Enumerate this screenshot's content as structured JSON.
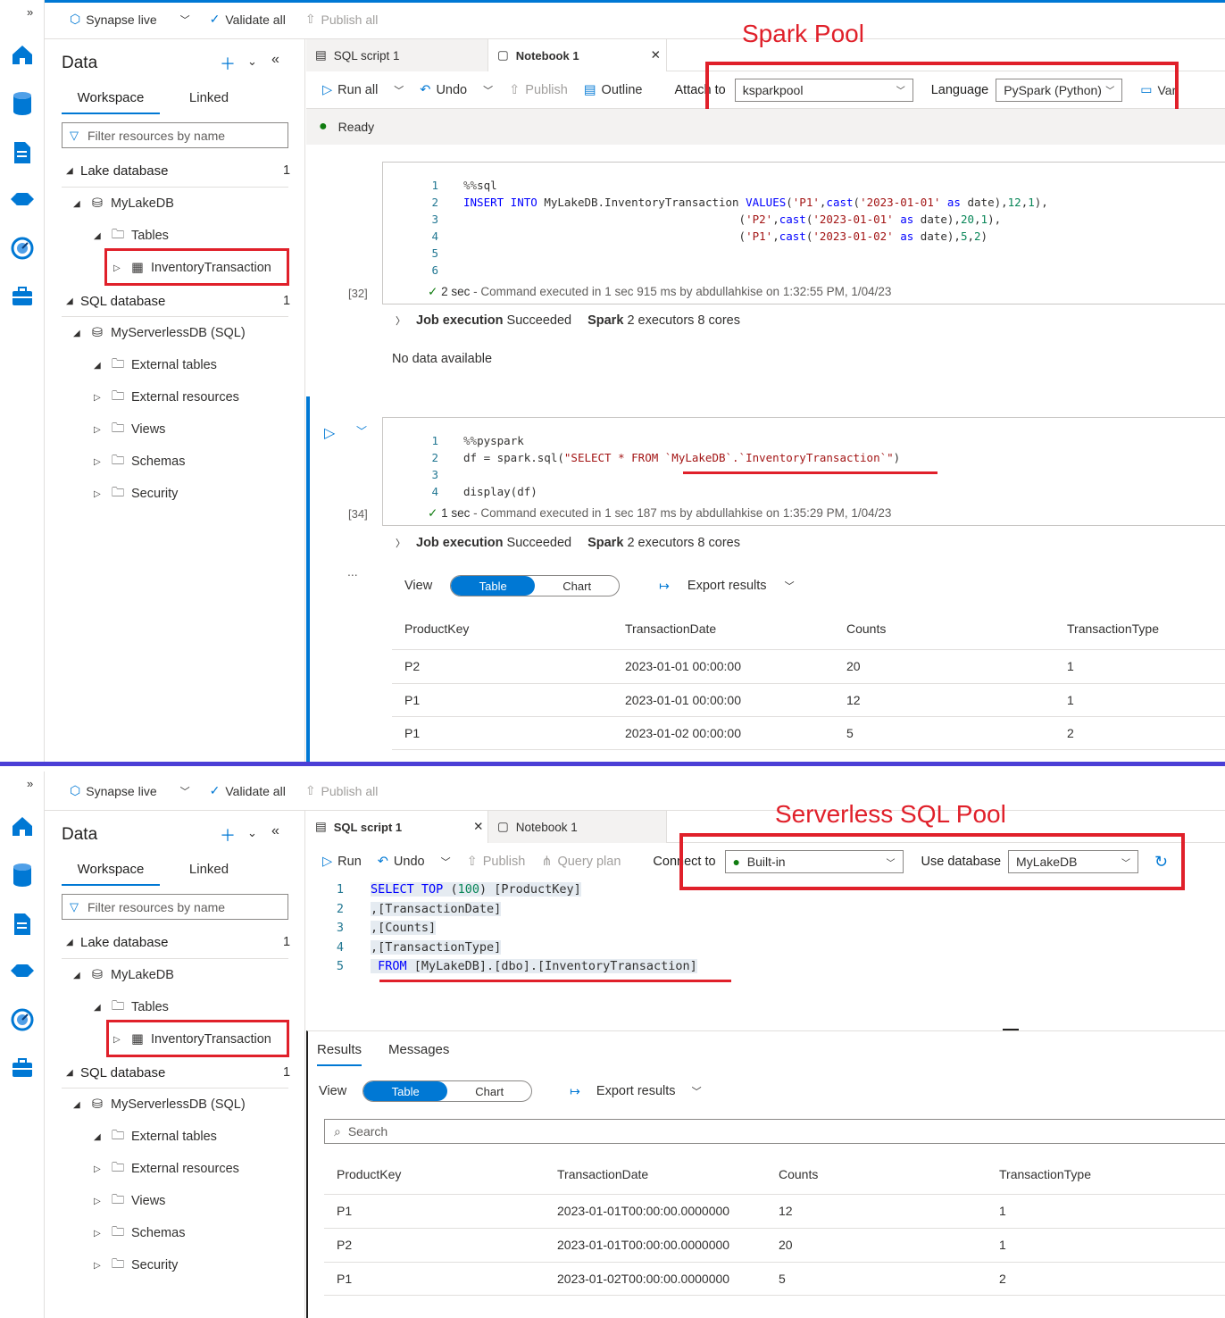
{
  "annotations": {
    "top": "Spark Pool",
    "bottom": "Serverless SQL Pool"
  },
  "header": {
    "live": "Synapse live",
    "validate": "Validate all",
    "publish": "Publish all"
  },
  "sidebar": {
    "title": "Data",
    "tabs": [
      "Workspace",
      "Linked"
    ],
    "filter_placeholder": "Filter resources by name",
    "lake_section": "Lake database",
    "lake_count": "1",
    "lake_db": "MyLakeDB",
    "tables": "Tables",
    "table_item": "InventoryTransaction",
    "sql_section": "SQL database",
    "sql_count": "1",
    "sql_db": "MyServerlessDB (SQL)",
    "sql_children": [
      "External tables",
      "External resources",
      "Views",
      "Schemas",
      "Security"
    ]
  },
  "top": {
    "tabs": [
      "SQL script 1",
      "Notebook 1"
    ],
    "toolbar": {
      "run_all": "Run all",
      "undo": "Undo",
      "publish": "Publish",
      "outline": "Outline",
      "attach_label": "Attach to",
      "attach_value": "ksparkpool",
      "language_label": "Language",
      "language_value": "PySpark (Python)",
      "var": "Var"
    },
    "status": "Ready",
    "cell1": {
      "exec_count": "[32]",
      "line_numbers": [
        "1",
        "2",
        "3",
        "4",
        "5",
        "6"
      ],
      "result_time": "2 sec",
      "result_text": "- Command executed in 1 sec 915 ms by abdullahkise on 1:32:55 PM, 1/04/23",
      "job_label": "Job execution",
      "job_status": "Succeeded",
      "spark_label": "Spark",
      "spark_info": "2 executors 8 cores",
      "no_data": "No data available"
    },
    "cell2": {
      "exec_count": "[34]",
      "line_numbers": [
        "1",
        "2",
        "3",
        "4"
      ],
      "result_time": "1 sec",
      "result_text": "- Command executed in 1 sec 187 ms by abdullahkise on 1:35:29 PM, 1/04/23",
      "job_label": "Job execution",
      "job_status": "Succeeded",
      "spark_label": "Spark",
      "spark_info": "2 executors 8 cores",
      "more": "..."
    },
    "view_label": "View",
    "toggle": [
      "Table",
      "Chart"
    ],
    "export": "Export results",
    "columns": [
      "ProductKey",
      "TransactionDate",
      "Counts",
      "TransactionType"
    ],
    "rows": [
      [
        "P2",
        "2023-01-01 00:00:00",
        "20",
        "1"
      ],
      [
        "P1",
        "2023-01-01 00:00:00",
        "12",
        "1"
      ],
      [
        "P1",
        "2023-01-02 00:00:00",
        "5",
        "2"
      ]
    ]
  },
  "bottom": {
    "tabs": [
      "SQL script 1",
      "Notebook 1"
    ],
    "toolbar": {
      "run": "Run",
      "undo": "Undo",
      "publish": "Publish",
      "query_plan": "Query plan",
      "connect_label": "Connect to",
      "connect_value": "Built-in",
      "db_label": "Use database",
      "db_value": "MyLakeDB"
    },
    "line_numbers": [
      "1",
      "2",
      "3",
      "4",
      "5"
    ],
    "result_tabs": [
      "Results",
      "Messages"
    ],
    "view_label": "View",
    "toggle": [
      "Table",
      "Chart"
    ],
    "export": "Export results",
    "search_placeholder": "Search",
    "columns": [
      "ProductKey",
      "TransactionDate",
      "Counts",
      "TransactionType"
    ],
    "rows": [
      [
        "P1",
        "2023-01-01T00:00:00.0000000",
        "12",
        "1"
      ],
      [
        "P2",
        "2023-01-01T00:00:00.0000000",
        "20",
        "1"
      ],
      [
        "P1",
        "2023-01-02T00:00:00.0000000",
        "5",
        "2"
      ]
    ]
  },
  "colors": {
    "accent": "#0078d4",
    "annotation": "#e0202a",
    "divider": "#4b3fd6"
  }
}
